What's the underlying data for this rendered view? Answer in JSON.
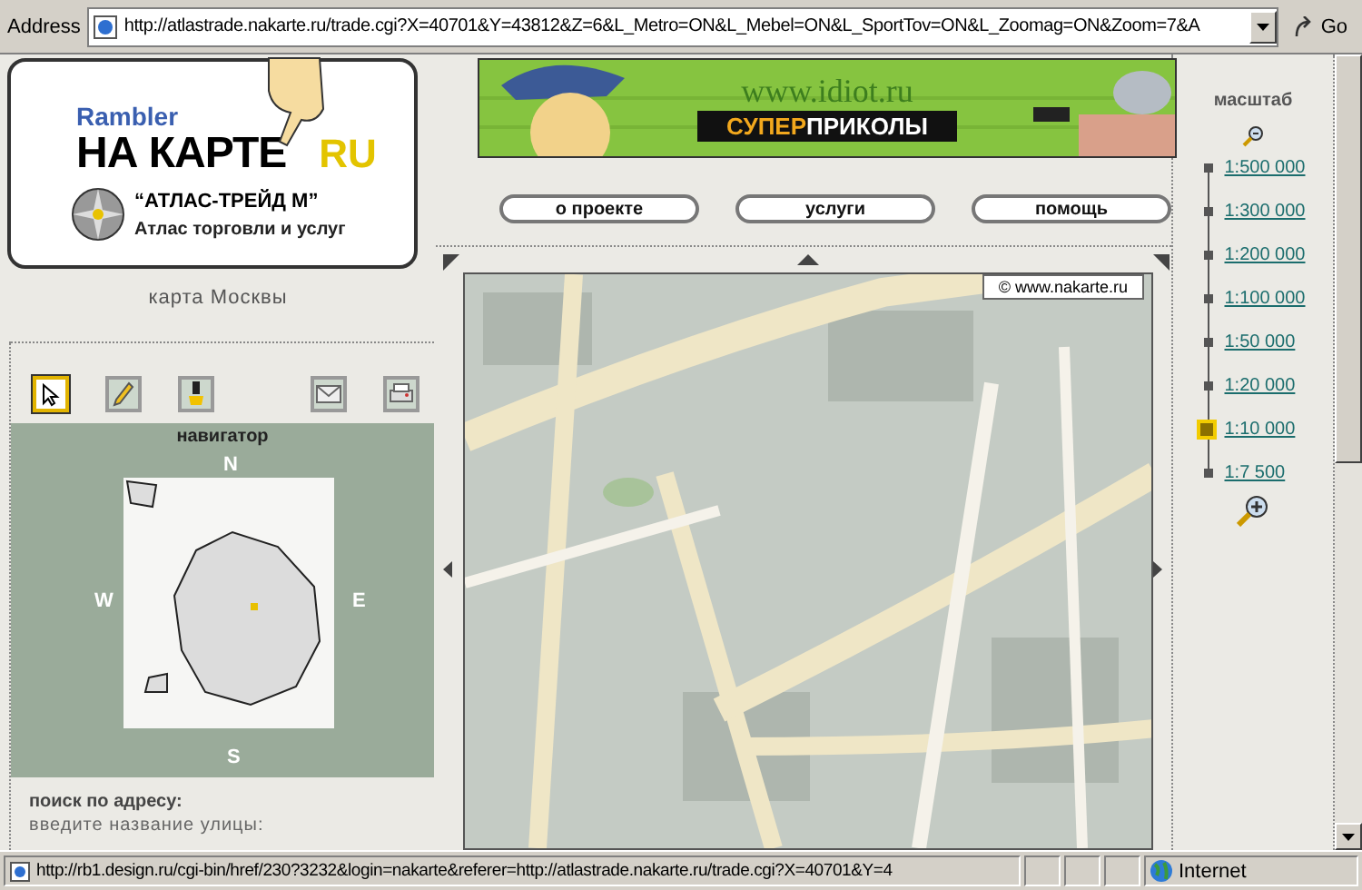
{
  "address_bar": {
    "label": "Address",
    "url": "http://atlastrade.nakarte.ru/trade.cgi?X=40701&Y=43812&Z=6&L_Metro=ON&L_Mebel=ON&L_SportTov=ON&L_Zoomag=ON&Zoom=7&A",
    "go_button": "Go"
  },
  "logo": {
    "brand": "Rambler",
    "title": "НА КАРТЕ",
    "suffix": "RU",
    "company": "“АТЛАС-ТРЕЙД М”",
    "tagline": "Атлас торговли и услуг"
  },
  "map_title": "карта Москвы",
  "tools": [
    {
      "kind": "select",
      "selected": true
    },
    {
      "kind": "pencil",
      "selected": false
    },
    {
      "kind": "marker",
      "selected": false
    },
    {
      "kind": "mail",
      "selected": false
    },
    {
      "kind": "print",
      "selected": false
    }
  ],
  "navigator": {
    "title": "навигатор",
    "north": "N",
    "west": "W",
    "east": "E",
    "south": "S"
  },
  "address_search": {
    "title": "поиск по адресу:",
    "hint": "введите название улицы:"
  },
  "banner": {
    "url": "www.idiot.ru",
    "highlight": "СУПЕР",
    "text": "ПРИКОЛЫ"
  },
  "nav_buttons": [
    "о проекте",
    "услуги",
    "помощь"
  ],
  "map": {
    "copyright": "© www.nakarte.ru"
  },
  "scale": {
    "title": "масштаб",
    "levels": [
      {
        "label": "1:500 000",
        "selected": false
      },
      {
        "label": "1:300 000",
        "selected": false
      },
      {
        "label": "1:200 000",
        "selected": false
      },
      {
        "label": "1:100 000",
        "selected": false
      },
      {
        "label": "1:50 000",
        "selected": false
      },
      {
        "label": "1:20 000",
        "selected": false
      },
      {
        "label": "1:10 000",
        "selected": true
      },
      {
        "label": "1:7 500",
        "selected": false
      }
    ]
  },
  "status_bar": {
    "url": "http://rb1.design.ru/cgi-bin/href/230?3232&login=nakarte&referer=http://atlastrade.nakarte.ru/trade.cgi?X=40701&Y=4",
    "zone": "Internet"
  }
}
